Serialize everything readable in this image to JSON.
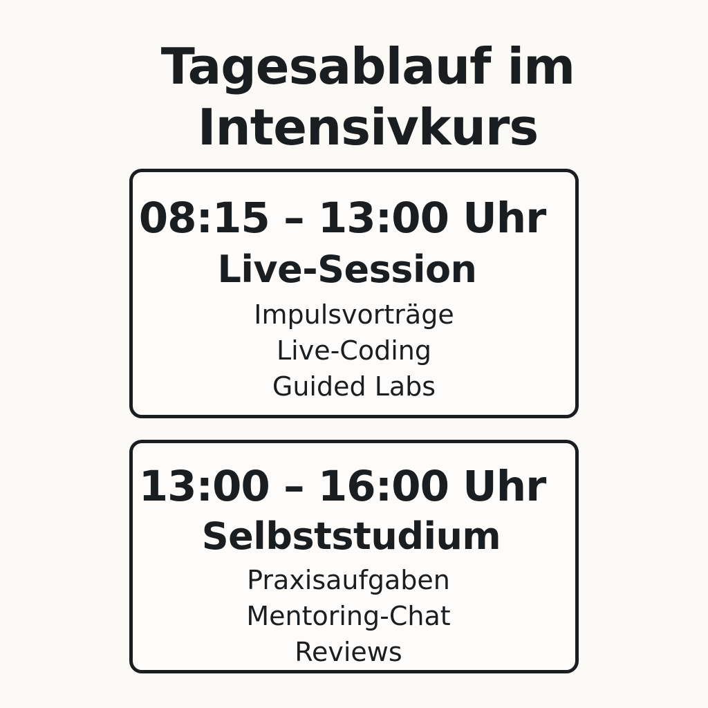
{
  "title": {
    "line1": "Tagesablauf im",
    "line2": "Intensivkurs"
  },
  "blocks": [
    {
      "time": "08:15 – 13:00 Uhr",
      "label": "Live-Session",
      "items": [
        "Impulsvorträge",
        "Live-Coding",
        "Guided Labs"
      ]
    },
    {
      "time": "13:00 – 16:00 Uhr",
      "label": "Selbststudium",
      "items": [
        "Praxisaufgaben",
        "Mentoring-Chat",
        "Reviews"
      ]
    }
  ],
  "colors": {
    "background": "#fbfaf6",
    "ink": "#1b1e21"
  }
}
